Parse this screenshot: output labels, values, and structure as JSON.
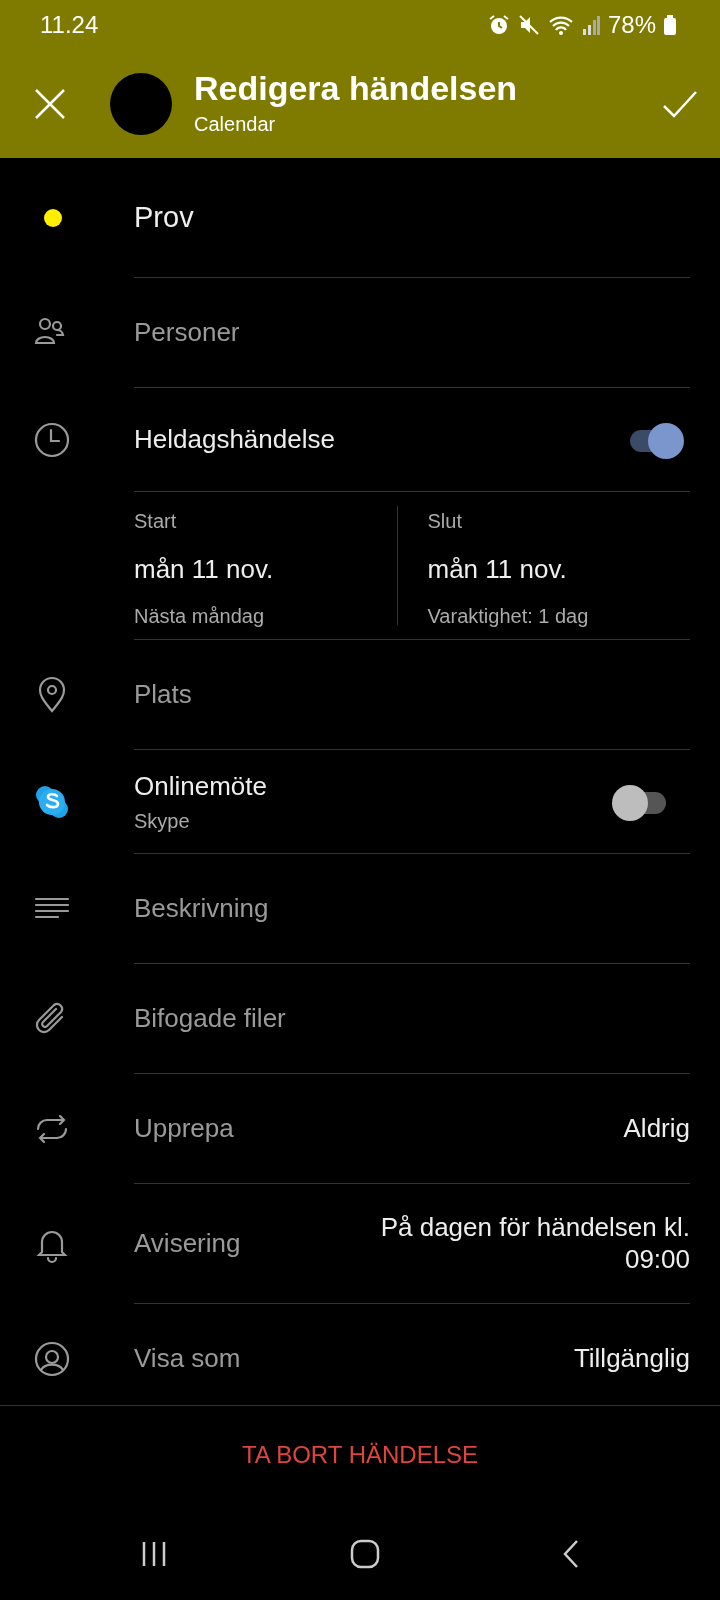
{
  "status_bar": {
    "time": "11.24",
    "battery": "78%"
  },
  "header": {
    "title": "Redigera händelsen",
    "subtitle": "Calendar"
  },
  "event": {
    "title": "Prov",
    "color": "#ffee00"
  },
  "rows": [
    {
      "kind": "field",
      "label": "Personer"
    },
    {
      "kind": "toggle",
      "label": "Heldagshändelse",
      "on": true
    },
    {
      "kind": "dates",
      "start": {
        "label": "Start",
        "date": "mån 11 nov.",
        "note": "Nästa måndag"
      },
      "end": {
        "label": "Slut",
        "date": "mån 11 nov.",
        "note": "Varaktighet: 1 dag"
      }
    },
    {
      "kind": "field",
      "label": "Plats"
    },
    {
      "kind": "toggle",
      "label": "Onlinemöte",
      "sublabel": "Skype",
      "on": false
    },
    {
      "kind": "field",
      "label": "Beskrivning"
    },
    {
      "kind": "field",
      "label": "Bifogade filer"
    },
    {
      "kind": "value",
      "label": "Upprepa",
      "value": "Aldrig"
    },
    {
      "kind": "value",
      "label": "Avisering",
      "value": "På dagen för händelsen kl. 09:00"
    },
    {
      "kind": "value",
      "label": "Visa som",
      "value": "Tillgänglig"
    }
  ],
  "delete_button": "TA BORT HÄNDELSE"
}
